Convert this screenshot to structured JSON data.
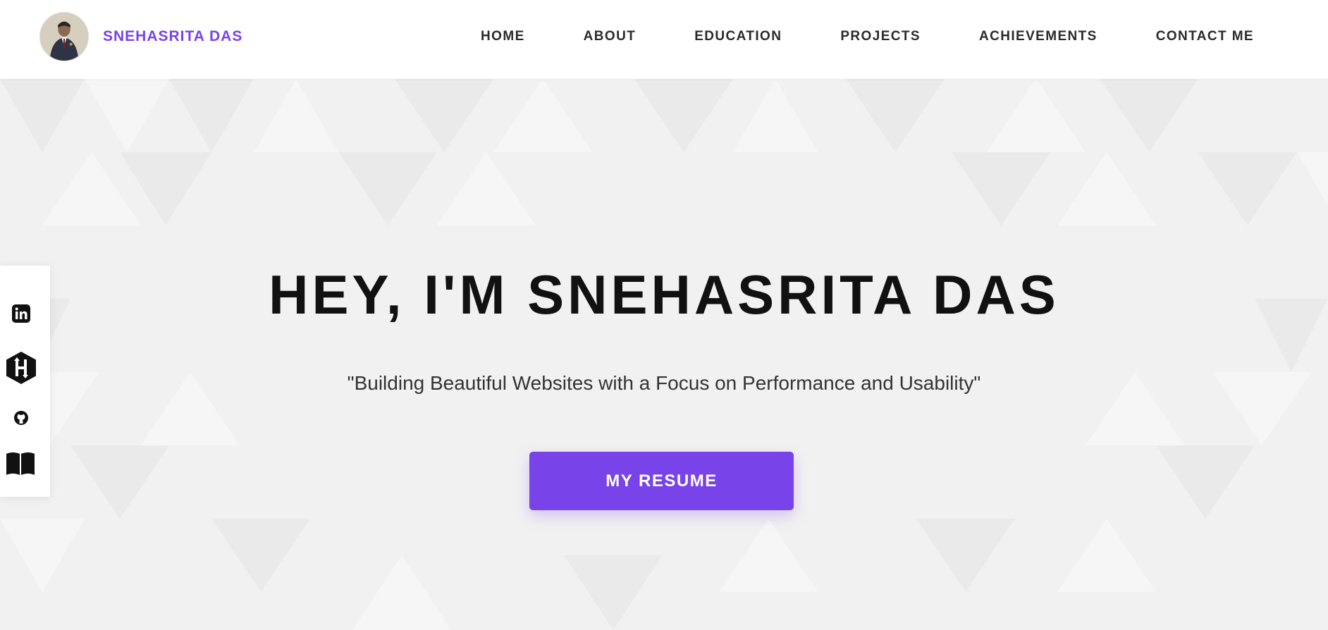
{
  "brand": {
    "name": "SNEHASRITA DAS"
  },
  "nav": {
    "items": [
      "HOME",
      "ABOUT",
      "EDUCATION",
      "PROJECTS",
      "ACHIEVEMENTS",
      "CONTACT ME"
    ]
  },
  "hero": {
    "title": "HEY, I'M SNEHASRITA DAS",
    "subtitle": "\"Building Beautiful Websites with a Focus on Performance and Usability\"",
    "button_label": "MY RESUME"
  },
  "social": {
    "icons": [
      "linkedin-icon",
      "hackerrank-icon",
      "github-icon",
      "book-icon"
    ]
  },
  "colors": {
    "accent": "#7843e9",
    "nav_text": "#2a2a2a",
    "hero_bg": "#f1f1f1",
    "title_text": "#111111"
  }
}
